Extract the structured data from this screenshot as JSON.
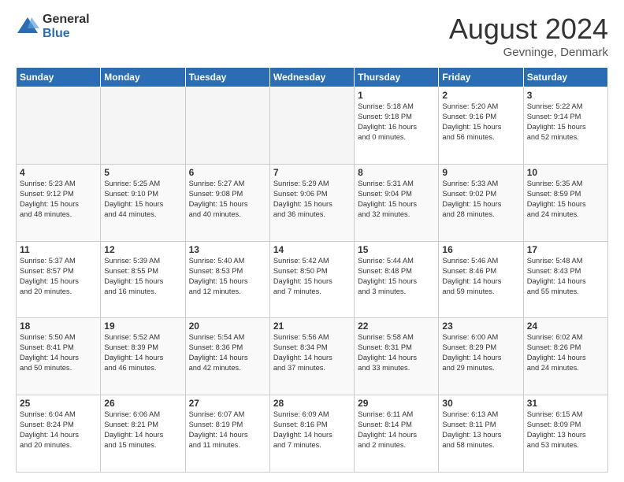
{
  "header": {
    "logo_general": "General",
    "logo_blue": "Blue",
    "month_title": "August 2024",
    "location": "Gevninge, Denmark"
  },
  "days_of_week": [
    "Sunday",
    "Monday",
    "Tuesday",
    "Wednesday",
    "Thursday",
    "Friday",
    "Saturday"
  ],
  "weeks": [
    [
      {
        "day": "",
        "info": ""
      },
      {
        "day": "",
        "info": ""
      },
      {
        "day": "",
        "info": ""
      },
      {
        "day": "",
        "info": ""
      },
      {
        "day": "1",
        "info": "Sunrise: 5:18 AM\nSunset: 9:18 PM\nDaylight: 16 hours\nand 0 minutes."
      },
      {
        "day": "2",
        "info": "Sunrise: 5:20 AM\nSunset: 9:16 PM\nDaylight: 15 hours\nand 56 minutes."
      },
      {
        "day": "3",
        "info": "Sunrise: 5:22 AM\nSunset: 9:14 PM\nDaylight: 15 hours\nand 52 minutes."
      }
    ],
    [
      {
        "day": "4",
        "info": "Sunrise: 5:23 AM\nSunset: 9:12 PM\nDaylight: 15 hours\nand 48 minutes."
      },
      {
        "day": "5",
        "info": "Sunrise: 5:25 AM\nSunset: 9:10 PM\nDaylight: 15 hours\nand 44 minutes."
      },
      {
        "day": "6",
        "info": "Sunrise: 5:27 AM\nSunset: 9:08 PM\nDaylight: 15 hours\nand 40 minutes."
      },
      {
        "day": "7",
        "info": "Sunrise: 5:29 AM\nSunset: 9:06 PM\nDaylight: 15 hours\nand 36 minutes."
      },
      {
        "day": "8",
        "info": "Sunrise: 5:31 AM\nSunset: 9:04 PM\nDaylight: 15 hours\nand 32 minutes."
      },
      {
        "day": "9",
        "info": "Sunrise: 5:33 AM\nSunset: 9:02 PM\nDaylight: 15 hours\nand 28 minutes."
      },
      {
        "day": "10",
        "info": "Sunrise: 5:35 AM\nSunset: 8:59 PM\nDaylight: 15 hours\nand 24 minutes."
      }
    ],
    [
      {
        "day": "11",
        "info": "Sunrise: 5:37 AM\nSunset: 8:57 PM\nDaylight: 15 hours\nand 20 minutes."
      },
      {
        "day": "12",
        "info": "Sunrise: 5:39 AM\nSunset: 8:55 PM\nDaylight: 15 hours\nand 16 minutes."
      },
      {
        "day": "13",
        "info": "Sunrise: 5:40 AM\nSunset: 8:53 PM\nDaylight: 15 hours\nand 12 minutes."
      },
      {
        "day": "14",
        "info": "Sunrise: 5:42 AM\nSunset: 8:50 PM\nDaylight: 15 hours\nand 7 minutes."
      },
      {
        "day": "15",
        "info": "Sunrise: 5:44 AM\nSunset: 8:48 PM\nDaylight: 15 hours\nand 3 minutes."
      },
      {
        "day": "16",
        "info": "Sunrise: 5:46 AM\nSunset: 8:46 PM\nDaylight: 14 hours\nand 59 minutes."
      },
      {
        "day": "17",
        "info": "Sunrise: 5:48 AM\nSunset: 8:43 PM\nDaylight: 14 hours\nand 55 minutes."
      }
    ],
    [
      {
        "day": "18",
        "info": "Sunrise: 5:50 AM\nSunset: 8:41 PM\nDaylight: 14 hours\nand 50 minutes."
      },
      {
        "day": "19",
        "info": "Sunrise: 5:52 AM\nSunset: 8:39 PM\nDaylight: 14 hours\nand 46 minutes."
      },
      {
        "day": "20",
        "info": "Sunrise: 5:54 AM\nSunset: 8:36 PM\nDaylight: 14 hours\nand 42 minutes."
      },
      {
        "day": "21",
        "info": "Sunrise: 5:56 AM\nSunset: 8:34 PM\nDaylight: 14 hours\nand 37 minutes."
      },
      {
        "day": "22",
        "info": "Sunrise: 5:58 AM\nSunset: 8:31 PM\nDaylight: 14 hours\nand 33 minutes."
      },
      {
        "day": "23",
        "info": "Sunrise: 6:00 AM\nSunset: 8:29 PM\nDaylight: 14 hours\nand 29 minutes."
      },
      {
        "day": "24",
        "info": "Sunrise: 6:02 AM\nSunset: 8:26 PM\nDaylight: 14 hours\nand 24 minutes."
      }
    ],
    [
      {
        "day": "25",
        "info": "Sunrise: 6:04 AM\nSunset: 8:24 PM\nDaylight: 14 hours\nand 20 minutes."
      },
      {
        "day": "26",
        "info": "Sunrise: 6:06 AM\nSunset: 8:21 PM\nDaylight: 14 hours\nand 15 minutes."
      },
      {
        "day": "27",
        "info": "Sunrise: 6:07 AM\nSunset: 8:19 PM\nDaylight: 14 hours\nand 11 minutes."
      },
      {
        "day": "28",
        "info": "Sunrise: 6:09 AM\nSunset: 8:16 PM\nDaylight: 14 hours\nand 7 minutes."
      },
      {
        "day": "29",
        "info": "Sunrise: 6:11 AM\nSunset: 8:14 PM\nDaylight: 14 hours\nand 2 minutes."
      },
      {
        "day": "30",
        "info": "Sunrise: 6:13 AM\nSunset: 8:11 PM\nDaylight: 13 hours\nand 58 minutes."
      },
      {
        "day": "31",
        "info": "Sunrise: 6:15 AM\nSunset: 8:09 PM\nDaylight: 13 hours\nand 53 minutes."
      }
    ]
  ]
}
